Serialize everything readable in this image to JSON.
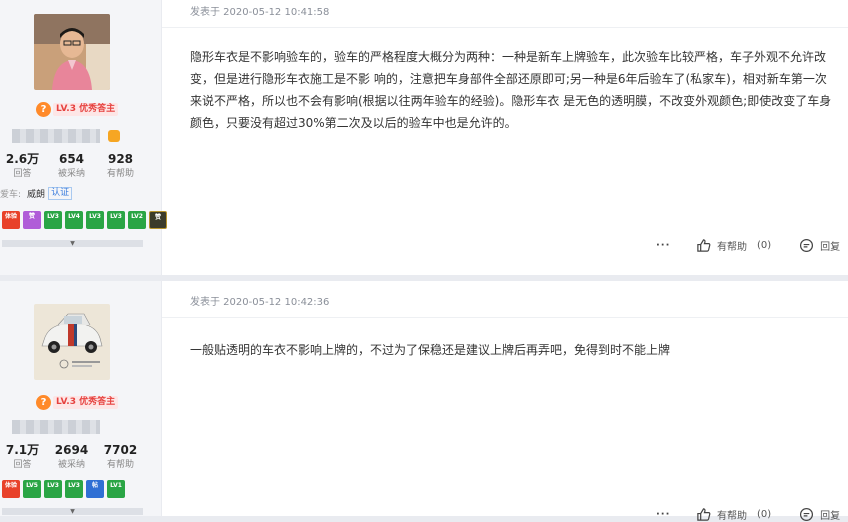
{
  "posts": [
    {
      "timestamp": "发表于 2020-05-12 10:41:58",
      "content": "隐形车衣是不影响验车的，验车的严格程度大概分为两种：一种是新车上牌验车，此次验车比较严格，车子外观不允许改变，但是进行隐形车衣施工是不影 响的，注意把车身部件全部还原即可;另一种是6年后验车了(私家车)，相对新车第一次来说不严格，所以也不会有影响(根据以往两年验车的经验)。隐形车衣 是无色的透明膜，不改变外观颜色;即使改变了车身颜色，只要没有超过30%第二次及以后的验车中也是允许的。",
      "author": {
        "level_badge": "LV.3 优秀答主",
        "stats": [
          {
            "num": "2.6万",
            "label": "回答"
          },
          {
            "num": "654",
            "label": "被采纳"
          },
          {
            "num": "928",
            "label": "有帮助"
          }
        ],
        "love_car_label": "爱车:",
        "love_car": "威朗",
        "auth_label": "认证",
        "medals": [
          {
            "text": "体验",
            "color": "red"
          },
          {
            "text": "赞",
            "color": "pur"
          },
          {
            "text": "LV3",
            "color": "grn"
          },
          {
            "text": "LV4",
            "color": "grn"
          },
          {
            "text": "LV3",
            "color": "grn"
          },
          {
            "text": "LV3",
            "color": "grn"
          },
          {
            "text": "LV2",
            "color": "grn"
          },
          {
            "text": "赞",
            "color": "dk"
          }
        ]
      },
      "actions": {
        "more": "···",
        "helpful": "有帮助",
        "helpful_count": "(0)",
        "reply": "回复"
      }
    },
    {
      "timestamp": "发表于 2020-05-12 10:42:36",
      "content": "一般贴透明的车衣不影响上牌的，不过为了保稳还是建议上牌后再弄吧，免得到时不能上牌",
      "author": {
        "level_badge": "LV.3 优秀答主",
        "stats": [
          {
            "num": "7.1万",
            "label": "回答"
          },
          {
            "num": "2694",
            "label": "被采纳"
          },
          {
            "num": "7702",
            "label": "有帮助"
          }
        ],
        "medals": [
          {
            "text": "体验",
            "color": "red"
          },
          {
            "text": "LV5",
            "color": "grn"
          },
          {
            "text": "LV3",
            "color": "grn"
          },
          {
            "text": "LV3",
            "color": "grn"
          },
          {
            "text": "帖",
            "color": "blu"
          },
          {
            "text": "LV1",
            "color": "grn"
          }
        ]
      },
      "actions": {
        "more": "···",
        "helpful": "有帮助",
        "helpful_count": "(0)",
        "reply": "回复"
      }
    }
  ],
  "colors": {
    "badge_orange": "#ff8a2a",
    "badge_red": "#e64340",
    "link_blue": "#3b7ddd"
  }
}
